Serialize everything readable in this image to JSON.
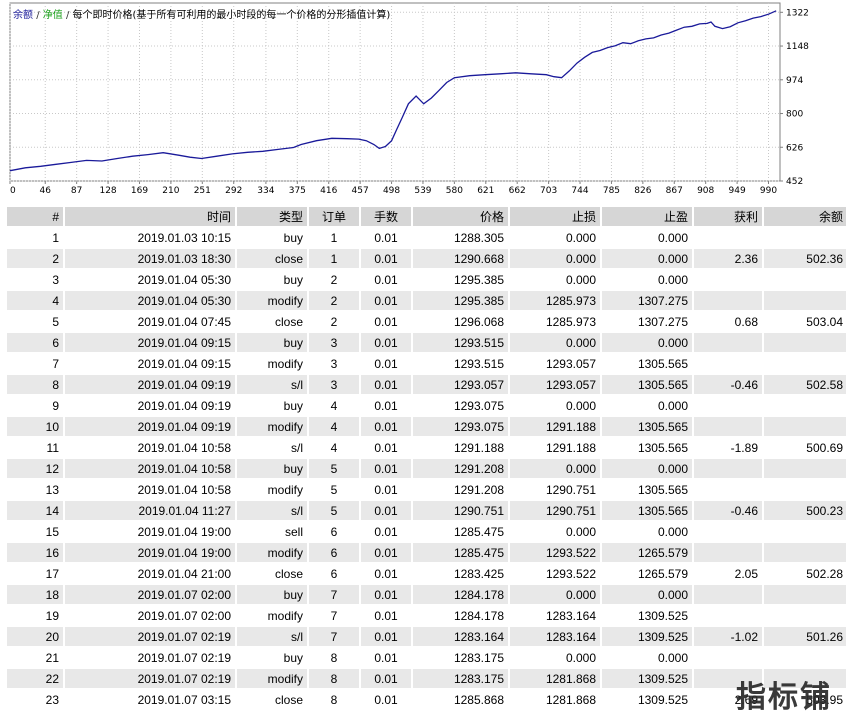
{
  "chart_data": {
    "type": "line",
    "legend": {
      "balance": "余额",
      "sep": "/",
      "equity": "净值",
      "description": "每个即时价格(基于所有可利用的最小时段的每一个价格的分形插值计算)"
    },
    "x_ticks": [
      0,
      46,
      87,
      128,
      169,
      210,
      251,
      292,
      334,
      375,
      416,
      457,
      498,
      539,
      580,
      621,
      662,
      703,
      744,
      785,
      826,
      867,
      908,
      949,
      990
    ],
    "y_ticks": [
      1322,
      1148,
      974,
      800,
      626,
      452
    ],
    "xlim": [
      0,
      1005
    ],
    "ylim": [
      452,
      1370
    ],
    "grid": true,
    "colors": {
      "balance": "#1a1a9a",
      "grid": "#c8c8c8",
      "axis": "#808080"
    },
    "series": [
      {
        "values_x": [
          0,
          20,
          40,
          60,
          80,
          100,
          120,
          140,
          160,
          180,
          200,
          220,
          235,
          250,
          270,
          290,
          310,
          330,
          350,
          370,
          380,
          400,
          420,
          440,
          455,
          465,
          475,
          482,
          490,
          498,
          505,
          512,
          520,
          530,
          540,
          550,
          560,
          570,
          580,
          600,
          620,
          640,
          660,
          680,
          700,
          710,
          720,
          730,
          740,
          750,
          760,
          770,
          780,
          790,
          800,
          810,
          820,
          830,
          840,
          850,
          860,
          870,
          880,
          890,
          900,
          910,
          915,
          920,
          930,
          940,
          950,
          960,
          970,
          980,
          990,
          1000
        ],
        "values_y": [
          505,
          520,
          528,
          538,
          548,
          558,
          555,
          568,
          580,
          588,
          598,
          585,
          575,
          568,
          580,
          592,
          600,
          605,
          615,
          625,
          640,
          660,
          672,
          670,
          668,
          660,
          640,
          620,
          630,
          660,
          720,
          780,
          850,
          890,
          850,
          880,
          920,
          960,
          985,
          995,
          1000,
          1005,
          1010,
          1005,
          1000,
          990,
          985,
          1020,
          1060,
          1090,
          1115,
          1125,
          1140,
          1150,
          1165,
          1160,
          1175,
          1185,
          1190,
          1205,
          1215,
          1230,
          1245,
          1250,
          1262,
          1265,
          1272,
          1250,
          1238,
          1248,
          1268,
          1278,
          1292,
          1300,
          1312,
          1330
        ]
      }
    ]
  },
  "table": {
    "headers": [
      "#",
      "时间",
      "类型",
      "订单",
      "手数",
      "价格",
      "止损",
      "止盈",
      "获利",
      "余额"
    ],
    "rows": [
      [
        "1",
        "2019.01.03 10:15",
        "buy",
        "1",
        "0.01",
        "1288.305",
        "0.000",
        "0.000",
        "",
        ""
      ],
      [
        "2",
        "2019.01.03 18:30",
        "close",
        "1",
        "0.01",
        "1290.668",
        "0.000",
        "0.000",
        "2.36",
        "502.36"
      ],
      [
        "3",
        "2019.01.04 05:30",
        "buy",
        "2",
        "0.01",
        "1295.385",
        "0.000",
        "0.000",
        "",
        ""
      ],
      [
        "4",
        "2019.01.04 05:30",
        "modify",
        "2",
        "0.01",
        "1295.385",
        "1285.973",
        "1307.275",
        "",
        ""
      ],
      [
        "5",
        "2019.01.04 07:45",
        "close",
        "2",
        "0.01",
        "1296.068",
        "1285.973",
        "1307.275",
        "0.68",
        "503.04"
      ],
      [
        "6",
        "2019.01.04 09:15",
        "buy",
        "3",
        "0.01",
        "1293.515",
        "0.000",
        "0.000",
        "",
        ""
      ],
      [
        "7",
        "2019.01.04 09:15",
        "modify",
        "3",
        "0.01",
        "1293.515",
        "1293.057",
        "1305.565",
        "",
        ""
      ],
      [
        "8",
        "2019.01.04 09:19",
        "s/l",
        "3",
        "0.01",
        "1293.057",
        "1293.057",
        "1305.565",
        "-0.46",
        "502.58"
      ],
      [
        "9",
        "2019.01.04 09:19",
        "buy",
        "4",
        "0.01",
        "1293.075",
        "0.000",
        "0.000",
        "",
        ""
      ],
      [
        "10",
        "2019.01.04 09:19",
        "modify",
        "4",
        "0.01",
        "1293.075",
        "1291.188",
        "1305.565",
        "",
        ""
      ],
      [
        "11",
        "2019.01.04 10:58",
        "s/l",
        "4",
        "0.01",
        "1291.188",
        "1291.188",
        "1305.565",
        "-1.89",
        "500.69"
      ],
      [
        "12",
        "2019.01.04 10:58",
        "buy",
        "5",
        "0.01",
        "1291.208",
        "0.000",
        "0.000",
        "",
        ""
      ],
      [
        "13",
        "2019.01.04 10:58",
        "modify",
        "5",
        "0.01",
        "1291.208",
        "1290.751",
        "1305.565",
        "",
        ""
      ],
      [
        "14",
        "2019.01.04 11:27",
        "s/l",
        "5",
        "0.01",
        "1290.751",
        "1290.751",
        "1305.565",
        "-0.46",
        "500.23"
      ],
      [
        "15",
        "2019.01.04 19:00",
        "sell",
        "6",
        "0.01",
        "1285.475",
        "0.000",
        "0.000",
        "",
        ""
      ],
      [
        "16",
        "2019.01.04 19:00",
        "modify",
        "6",
        "0.01",
        "1285.475",
        "1293.522",
        "1265.579",
        "",
        ""
      ],
      [
        "17",
        "2019.01.04 21:00",
        "close",
        "6",
        "0.01",
        "1283.425",
        "1293.522",
        "1265.579",
        "2.05",
        "502.28"
      ],
      [
        "18",
        "2019.01.07 02:00",
        "buy",
        "7",
        "0.01",
        "1284.178",
        "0.000",
        "0.000",
        "",
        ""
      ],
      [
        "19",
        "2019.01.07 02:00",
        "modify",
        "7",
        "0.01",
        "1284.178",
        "1283.164",
        "1309.525",
        "",
        ""
      ],
      [
        "20",
        "2019.01.07 02:19",
        "s/l",
        "7",
        "0.01",
        "1283.164",
        "1283.164",
        "1309.525",
        "-1.02",
        "501.26"
      ],
      [
        "21",
        "2019.01.07 02:19",
        "buy",
        "8",
        "0.01",
        "1283.175",
        "0.000",
        "0.000",
        "",
        ""
      ],
      [
        "22",
        "2019.01.07 02:19",
        "modify",
        "8",
        "0.01",
        "1283.175",
        "1281.868",
        "1309.525",
        "",
        ""
      ],
      [
        "23",
        "2019.01.07 03:15",
        "close",
        "8",
        "0.01",
        "1285.868",
        "1281.868",
        "1309.525",
        "2.69",
        "503.95"
      ]
    ]
  },
  "watermark": "指标铺"
}
